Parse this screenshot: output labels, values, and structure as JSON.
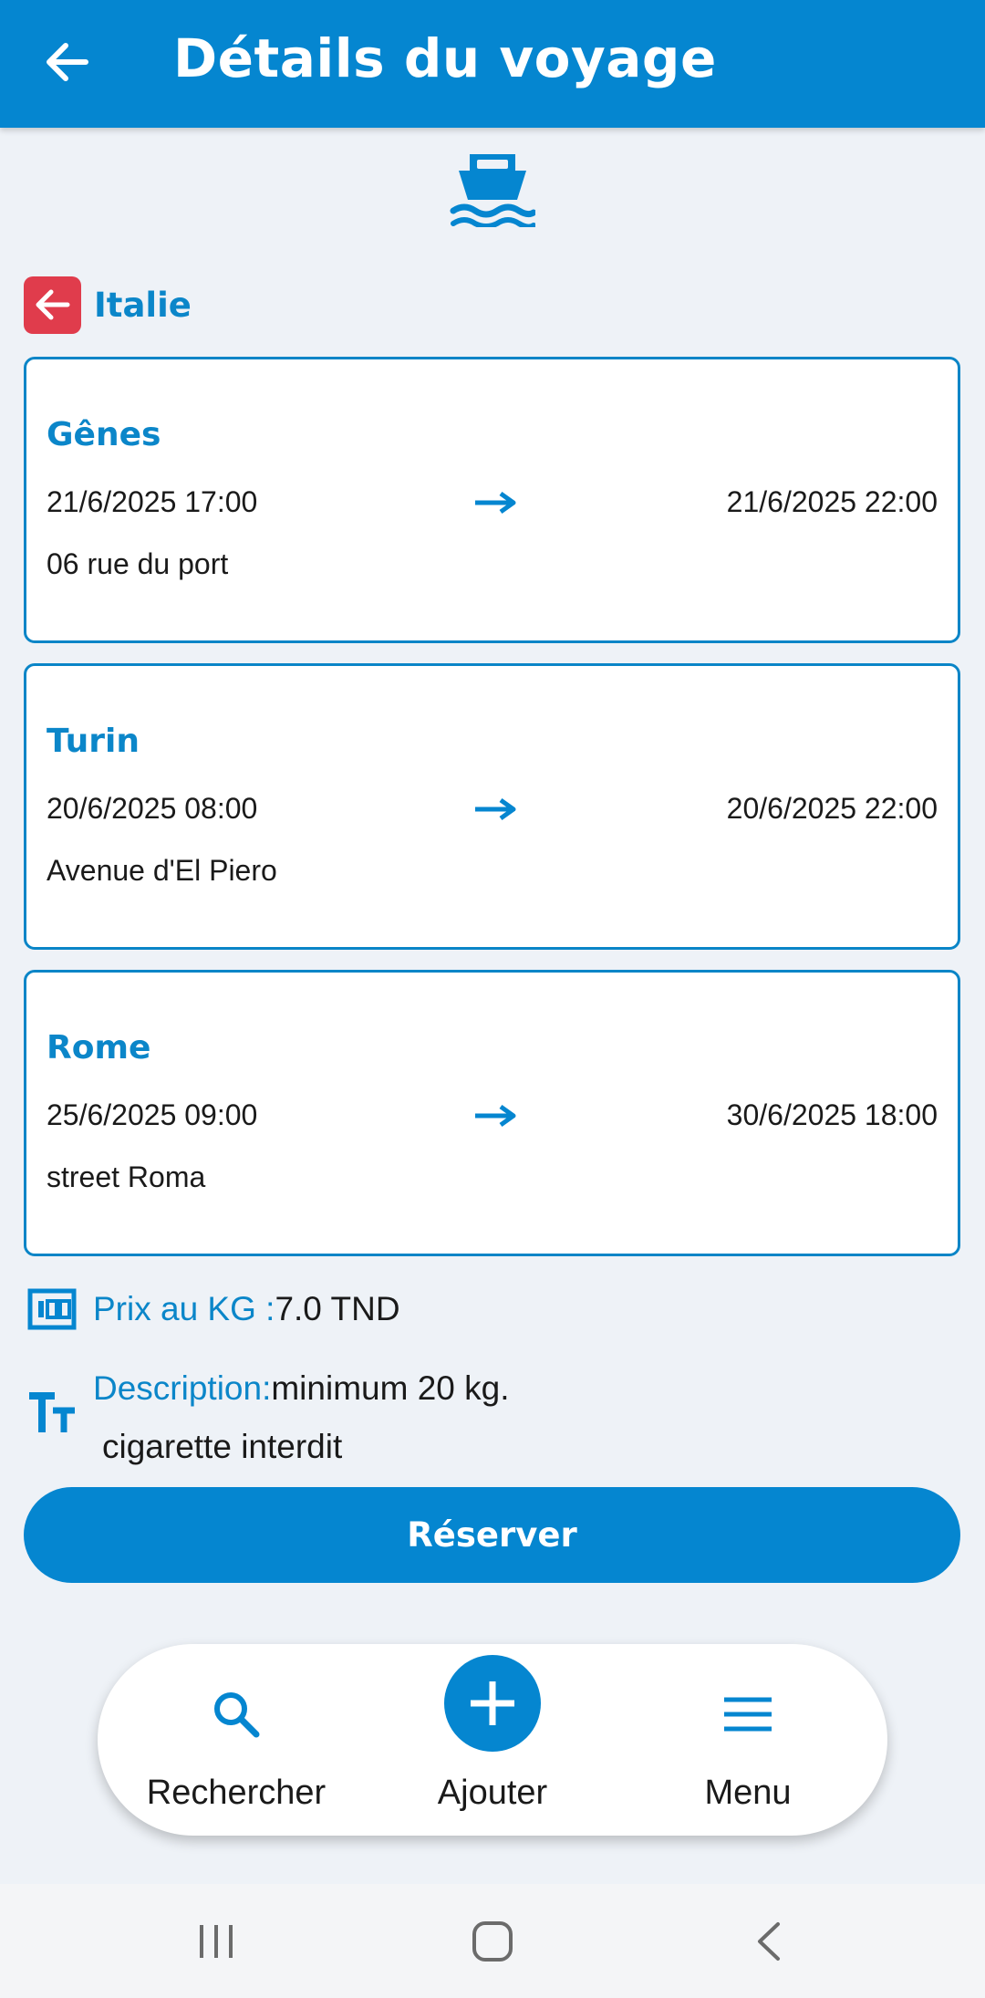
{
  "header": {
    "title": "Détails du voyage",
    "back_icon": "arrow-left-icon"
  },
  "transport": {
    "icon": "ship-icon",
    "color": "#0586d0"
  },
  "country": {
    "name": "Italie",
    "badge_color": "#e03c4c",
    "icon": "arrow-left-icon"
  },
  "stops": [
    {
      "city": "Gênes",
      "departure": "21/6/2025 17:00",
      "arrival": "21/6/2025 22:00",
      "address": "06 rue du port"
    },
    {
      "city": "Turin",
      "departure": "20/6/2025 08:00",
      "arrival": "20/6/2025 22:00",
      "address": "Avenue d'El Piero"
    },
    {
      "city": "Rome",
      "departure": "25/6/2025 09:00",
      "arrival": "30/6/2025 18:00",
      "address": "street Roma"
    }
  ],
  "price": {
    "label": "Prix au KG :",
    "value": "7.0 TND",
    "icon": "price-tag-icon"
  },
  "description": {
    "label": "Description:",
    "line1": "minimum 20 kg.",
    "line2": "cigarette interdit",
    "icon": "text-size-icon"
  },
  "reserve_button": "Réserver",
  "bottom_nav": {
    "items": [
      {
        "label": "Rechercher",
        "icon": "search-icon"
      },
      {
        "label": "Ajouter",
        "icon": "plus-icon"
      },
      {
        "label": "Menu",
        "icon": "hamburger-menu-icon"
      }
    ]
  },
  "system_nav": {
    "icons": [
      "recent-apps-icon",
      "home-icon",
      "back-chevron-icon"
    ]
  },
  "colors": {
    "primary": "#0586d0",
    "accent_text": "#0b86c9",
    "danger": "#e03c4c",
    "background": "#eef2f7"
  }
}
